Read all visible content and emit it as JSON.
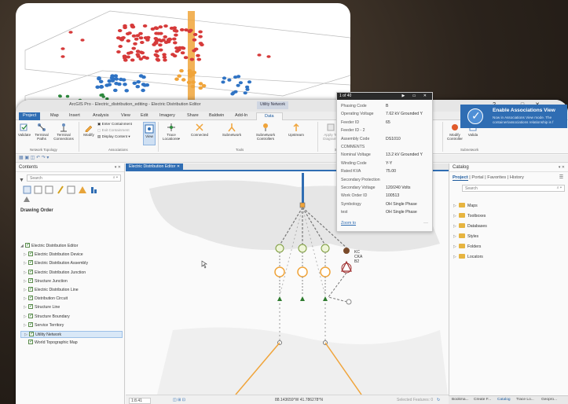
{
  "window": {
    "title": "ArcGIS Pro - Electric_distribution_editing - Electric Distribution Editor",
    "context_tab": "Utility Network",
    "controls": [
      "?",
      "–",
      "□",
      "✕"
    ]
  },
  "ribbon_tabs": [
    "Project",
    "Map",
    "Insert",
    "Analysis",
    "View",
    "Edit",
    "Imagery",
    "Share",
    "Baldwin",
    "Add-In",
    "Data"
  ],
  "ribbon": {
    "validate": "Validate",
    "terminal_paths": "Terminal Paths",
    "terminal_connections": "Terminal Connections",
    "group_network_topology": "Network Topology",
    "modify": "Modify",
    "enter_containment": "Enter Containment",
    "exit_containment": "Exit Containment",
    "display_content": "Display Content",
    "view": "View",
    "group_associations": "Associations",
    "trace_locations": "Trace Locations",
    "connected": "Connected",
    "subnetwork": "Subnetwork",
    "subnetwork_controllers": "Subnetwork Controllers",
    "upstream": "Upstream",
    "group_tools": "Tools",
    "apply_to_diagram": "Apply To Diagram",
    "apply_to_map": "Apply To Map",
    "group_selection": "Selection",
    "new": "New",
    "overwrite": "Overwrite",
    "append": "Append",
    "find": "Find",
    "group_diagram": "Diagram",
    "modify_controller": "Modify Controller",
    "validate2": "Valida",
    "group_subnetwork": "Subnetwork"
  },
  "contents": {
    "title": "Contents",
    "search_placeholder": "Search",
    "drawing_order": "Drawing Order",
    "layers": [
      "Electric Distribution Editor",
      "Electric Distribution Device",
      "Electric Distribution Assembly",
      "Electric Distribution Junction",
      "Structure Junction",
      "Electric Distribution Line",
      "Distribution Circuit",
      "Structure Line",
      "Structure Boundary",
      "Service Territory",
      "Utility Network",
      "World Topographic Map"
    ]
  },
  "map": {
    "tab_label": "Electric Distribution Editor",
    "scale": "1:8.41",
    "coordinates": "88.143659°W 41.786278°N",
    "selected_features": "Selected Features: 0",
    "xfmr_label": "KC\nCKA\nB2"
  },
  "popup": {
    "title": "1 of 40",
    "rows": [
      {
        "k": "Phasing Code",
        "v": "B"
      },
      {
        "k": "Operating Voltage",
        "v": "7.62 kV Grounded Y"
      },
      {
        "k": "Feeder ID",
        "v": "65"
      },
      {
        "k": "Feeder ID - 2",
        "v": ""
      },
      {
        "k": "Assembly Code",
        "v": "DS1010"
      },
      {
        "k": "COMMENTS",
        "v": ""
      },
      {
        "k": "Nominal Voltage",
        "v": "13.2 kV Grounded Y"
      },
      {
        "k": "Winding Code",
        "v": "Y-Y"
      },
      {
        "k": "Rated KVA",
        "v": "75.00"
      },
      {
        "k": "Secondary Protection",
        "v": ""
      },
      {
        "k": "Secondary Voltage",
        "v": "120/240 Volts"
      },
      {
        "k": "Work Order ID",
        "v": "100513"
      },
      {
        "k": "Symbology",
        "v": "OH Single Phase"
      },
      {
        "k": "test",
        "v": "OH Single Phase"
      }
    ],
    "zoom_to": "Zoom to"
  },
  "catalog": {
    "title": "Catalog",
    "tabs": [
      "Project",
      "Portal",
      "Favorites",
      "History"
    ],
    "search_placeholder": "Search",
    "items": [
      "Maps",
      "Toolboxes",
      "Databases",
      "Styles",
      "Folders",
      "Locators"
    ],
    "bottom_tabs": [
      "Bookma...",
      "Create F...",
      "Catalog",
      "Trace Lo...",
      "Geopro..."
    ]
  },
  "toast": {
    "heading": "Enable Associations View",
    "body": "Now in Associations View mode. The container/associations relationship is f"
  },
  "colors": {
    "accent": "#2f6db3",
    "viz_red": "#d63a3a",
    "viz_blue": "#2f73c4",
    "viz_orange": "#f0a43a",
    "viz_green": "#2e8b3e",
    "network_orange": "#f0a43a"
  }
}
